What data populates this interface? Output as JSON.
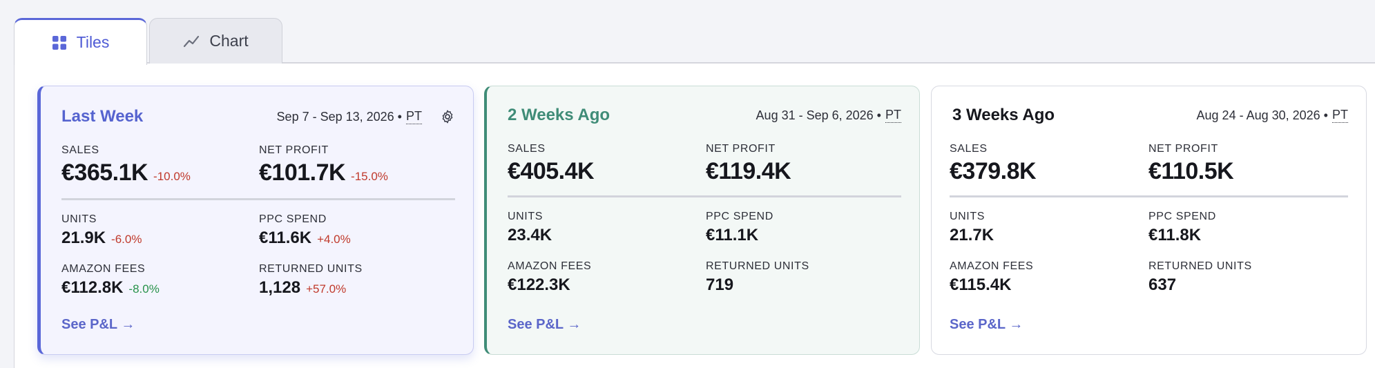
{
  "tabs": [
    {
      "label": "Tiles",
      "icon": "grid-icon",
      "active": true
    },
    {
      "label": "Chart",
      "icon": "line-chart-icon",
      "active": false
    }
  ],
  "colors": {
    "accent": "#5a67d8",
    "teal": "#3f8c77",
    "negative": "#c0392b",
    "positive": "#27924a"
  },
  "cards": [
    {
      "title": "Last Week",
      "date_range": "Sep 7 - Sep 13, 2026 •",
      "tz": "PT",
      "sales": {
        "label": "SALES",
        "value": "€365.1K",
        "delta": "-10.0%"
      },
      "net_profit": {
        "label": "NET PROFIT",
        "value": "€101.7K",
        "delta": "-15.0%"
      },
      "units": {
        "label": "UNITS",
        "value": "21.9K",
        "delta": "-6.0%"
      },
      "ppc_spend": {
        "label": "PPC SPEND",
        "value": "€11.6K",
        "delta": "+4.0%"
      },
      "amazon_fees": {
        "label": "AMAZON FEES",
        "value": "€112.8K",
        "delta": "-8.0%"
      },
      "returned_units": {
        "label": "RETURNED UNITS",
        "value": "1,128",
        "delta": "+57.0%"
      },
      "link": "See P&L →"
    },
    {
      "title": "2 Weeks Ago",
      "date_range": "Aug 31 - Sep 6, 2026 •",
      "tz": "PT",
      "sales": {
        "label": "SALES",
        "value": "€405.4K"
      },
      "net_profit": {
        "label": "NET PROFIT",
        "value": "€119.4K"
      },
      "units": {
        "label": "UNITS",
        "value": "23.4K"
      },
      "ppc_spend": {
        "label": "PPC SPEND",
        "value": "€11.1K"
      },
      "amazon_fees": {
        "label": "AMAZON FEES",
        "value": "€122.3K"
      },
      "returned_units": {
        "label": "RETURNED UNITS",
        "value": "719"
      },
      "link": "See P&L →"
    },
    {
      "title": "3 Weeks Ago",
      "date_range": "Aug 24 - Aug 30, 2026 •",
      "tz": "PT",
      "sales": {
        "label": "SALES",
        "value": "€379.8K"
      },
      "net_profit": {
        "label": "NET PROFIT",
        "value": "€110.5K"
      },
      "units": {
        "label": "UNITS",
        "value": "21.7K"
      },
      "ppc_spend": {
        "label": "PPC SPEND",
        "value": "€11.8K"
      },
      "amazon_fees": {
        "label": "AMAZON FEES",
        "value": "€115.4K"
      },
      "returned_units": {
        "label": "RETURNED UNITS",
        "value": "637"
      },
      "link": "See P&L →"
    }
  ]
}
